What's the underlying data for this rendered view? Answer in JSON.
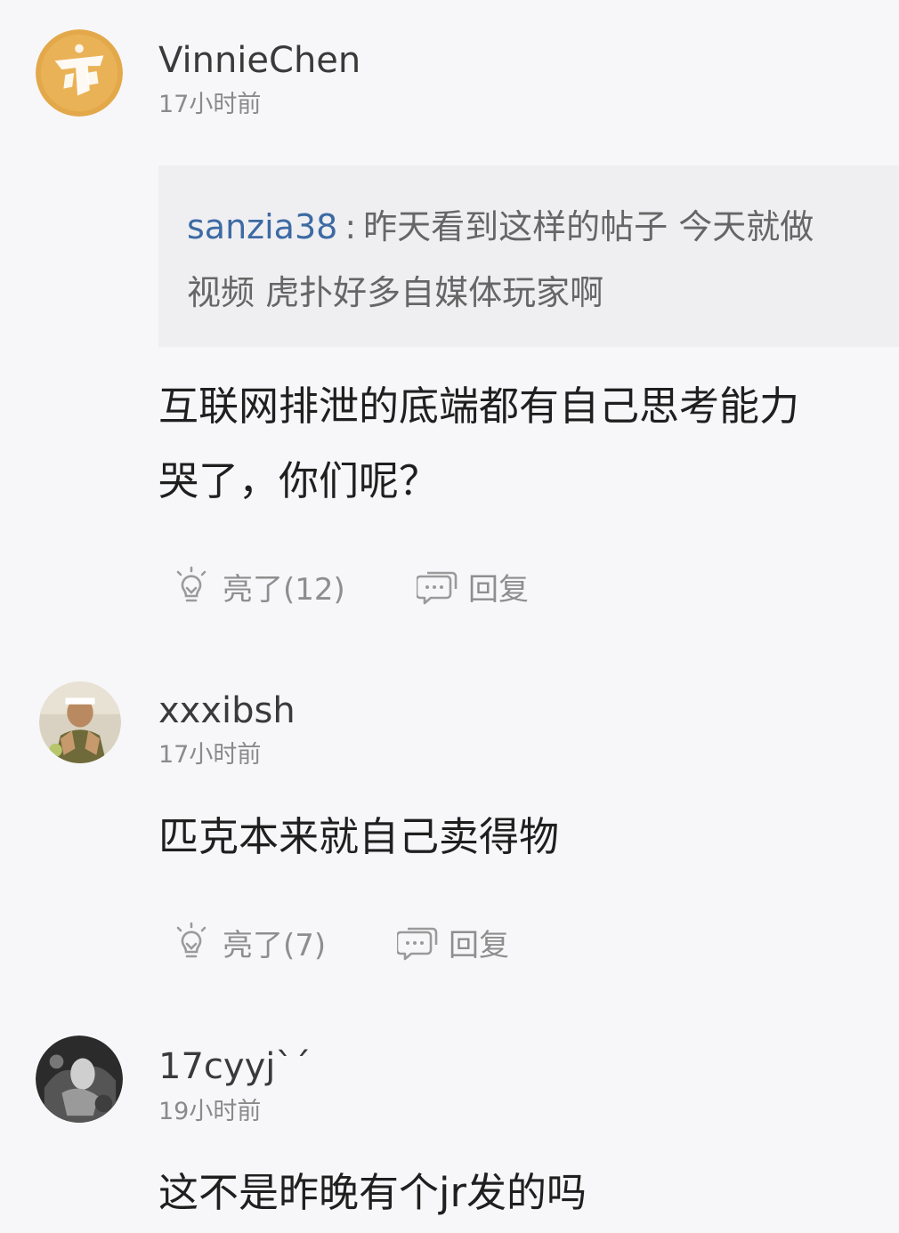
{
  "comments": [
    {
      "username": "VinnieChen",
      "time": "17小时前",
      "avatar_icon": "gold-badge-avatar",
      "quote": {
        "user": "sanzia38",
        "separator": ":",
        "line1": "昨天看到这样的帖子 今天就做",
        "line2": "视频 虎扑好多自媒体玩家啊"
      },
      "text_line1": "互联网排泄的底端都有自己思考能力",
      "text_line2": "哭了，你们呢？",
      "like_label": "亮了(12)",
      "reply_label": "回复"
    },
    {
      "username": "xxxibsh",
      "time": "17小时前",
      "avatar_icon": "person-photo-avatar",
      "text_line1": "匹克本来就自己卖得物",
      "like_label": "亮了(7)",
      "reply_label": "回复"
    },
    {
      "username": "17cyyj`´",
      "time": "19小时前",
      "avatar_icon": "dark-photo-avatar",
      "text_line1": "这不是昨晚有个jr发的吗"
    }
  ],
  "icons": {
    "like": "lightbulb-icon",
    "reply": "chat-bubble-icon"
  },
  "colors": {
    "background": "#f7f7f9",
    "quote_background": "#efeff2",
    "quote_username": "#3d6aa3",
    "meta_text": "#8a8a8a"
  }
}
